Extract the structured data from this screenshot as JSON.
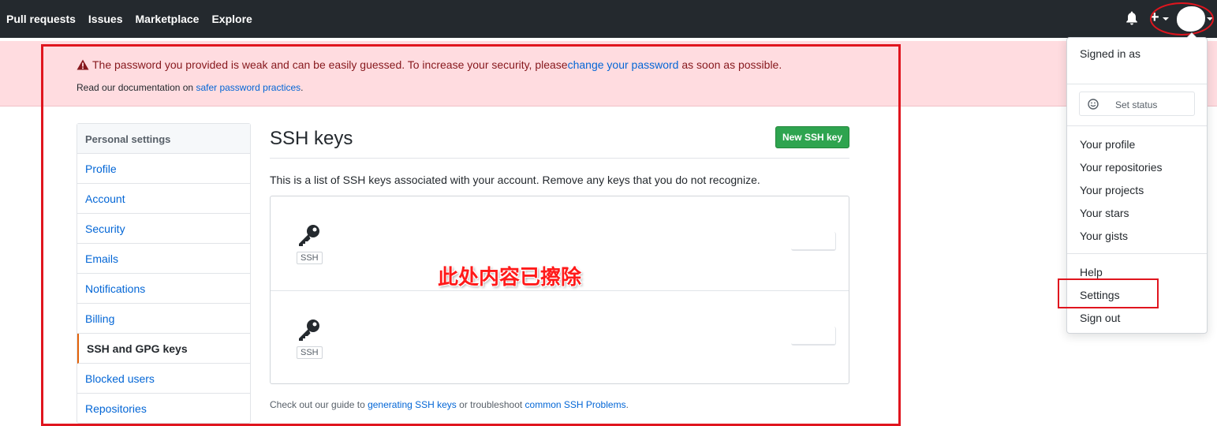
{
  "topnav": {
    "items": [
      "Pull requests",
      "Issues",
      "Marketplace",
      "Explore"
    ],
    "plus_label": "+"
  },
  "flash": {
    "line1_prefix": "The password you provided is weak and can be easily guessed. To increase your security, please ",
    "line1_link": "change your password",
    "line1_suffix": " as soon as possible.",
    "line2_prefix": "Read our documentation on ",
    "line2_link": "safer password practices",
    "line2_suffix": "."
  },
  "sidebar": {
    "heading": "Personal settings",
    "items": [
      {
        "label": "Profile"
      },
      {
        "label": "Account"
      },
      {
        "label": "Security"
      },
      {
        "label": "Emails"
      },
      {
        "label": "Notifications"
      },
      {
        "label": "Billing"
      },
      {
        "label": "SSH and GPG keys",
        "active": true
      },
      {
        "label": "Blocked users"
      },
      {
        "label": "Repositories"
      }
    ]
  },
  "main": {
    "title": "SSH keys",
    "new_key_label": "New SSH key",
    "description": "This is a list of SSH keys associated with your account. Remove any keys that you do not recognize.",
    "keys": [
      {
        "badge": "SSH"
      },
      {
        "badge": "SSH"
      }
    ],
    "erased_note": "此处内容已擦除",
    "footer_prefix": "Check out our guide to ",
    "footer_link1": "generating SSH keys",
    "footer_mid": " or troubleshoot ",
    "footer_link2": "common SSH Problems",
    "footer_suffix": "."
  },
  "dropdown": {
    "signed_in": "Signed in as",
    "set_status": "Set status",
    "items": [
      "Your profile",
      "Your repositories",
      "Your projects",
      "Your stars",
      "Your gists"
    ],
    "help": "Help",
    "settings": "Settings",
    "sign_out": "Sign out"
  },
  "colors": {
    "annotation_red": "#e0151e",
    "link_blue": "#0366d6",
    "primary_green": "#2ea44f",
    "flash_bg": "#ffdce0"
  }
}
